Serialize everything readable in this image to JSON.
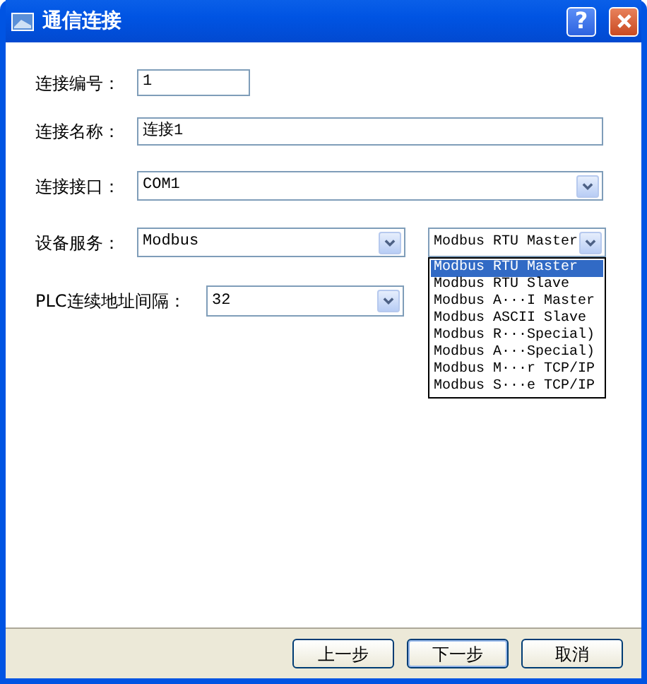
{
  "window": {
    "title": "通信连接",
    "help": "?"
  },
  "fields": [
    {
      "label": "连接编号：",
      "kind": "text",
      "value": "1"
    },
    {
      "label": "连接名称：",
      "kind": "text",
      "value": "连接1"
    },
    {
      "label": "连接接口：",
      "kind": "select",
      "value": "COM1"
    },
    {
      "label": "设备服务：",
      "kind": "select",
      "value": "Modbus"
    },
    {
      "label": "PLC连续地址间隔：",
      "kind": "select",
      "value": "32"
    }
  ],
  "protocol_select": {
    "value": "Modbus RTU Master",
    "expanded": true,
    "options": [
      {
        "label": "Modbus RTU Master",
        "selected": true
      },
      {
        "label": "Modbus RTU Slave",
        "selected": false
      },
      {
        "label": "Modbus A···I Master",
        "selected": false
      },
      {
        "label": "Modbus ASCII Slave",
        "selected": false
      },
      {
        "label": "Modbus R···Special)",
        "selected": false
      },
      {
        "label": "Modbus A···Special)",
        "selected": false
      },
      {
        "label": "Modbus M···r TCP/IP",
        "selected": false
      },
      {
        "label": "Modbus S···e TCP/IP",
        "selected": false
      }
    ]
  },
  "buttons": [
    {
      "label": "上一步",
      "default": false
    },
    {
      "label": "下一步",
      "default": true
    },
    {
      "label": "取消",
      "default": false
    }
  ]
}
